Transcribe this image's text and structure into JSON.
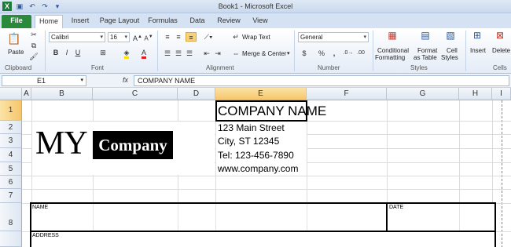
{
  "app": {
    "title": "Book1 - Microsoft Excel"
  },
  "tabs": [
    "File",
    "Home",
    "Insert",
    "Page Layout",
    "Formulas",
    "Data",
    "Review",
    "View"
  ],
  "ribbon": {
    "clipboard": {
      "paste_label": "Paste",
      "group_label": "Clipboard"
    },
    "font": {
      "name": "Calibri",
      "size": "16",
      "group_label": "Font",
      "bold": "B",
      "italic": "I",
      "underline": "U"
    },
    "alignment": {
      "wrap_label": "Wrap Text",
      "merge_label": "Merge & Center",
      "group_label": "Alignment"
    },
    "number": {
      "format": "General",
      "currency": "$",
      "percent": "%",
      "comma": ",",
      "group_label": "Number"
    },
    "styles": {
      "conditional_label_1": "Conditional",
      "conditional_label_2": "Formatting",
      "table_label_1": "Format",
      "table_label_2": "as Table",
      "cell_label_1": "Cell",
      "cell_label_2": "Styles",
      "group_label": "Styles"
    },
    "cells": {
      "insert_label": "Insert",
      "delete_label": "Delete",
      "group_label": "Cells"
    }
  },
  "formula_bar": {
    "name_box": "E1",
    "fx": "fx",
    "content": "COMPANY NAME"
  },
  "columns": [
    "A",
    "B",
    "C",
    "D",
    "E",
    "F",
    "G",
    "H",
    "I"
  ],
  "rows": [
    "1",
    "2",
    "3",
    "4",
    "5",
    "6",
    "7",
    "8"
  ],
  "logo": {
    "my": "MY",
    "company": "Company"
  },
  "cells": {
    "E1": "COMPANY NAME",
    "E2": "123 Main Street",
    "E3": "City, ST 12345",
    "E4": "Tel: 123-456-7890",
    "E5": "www.company.com",
    "B8_name": "NAME",
    "G8_date": "DATE",
    "B9_address": "ADDRESS"
  }
}
